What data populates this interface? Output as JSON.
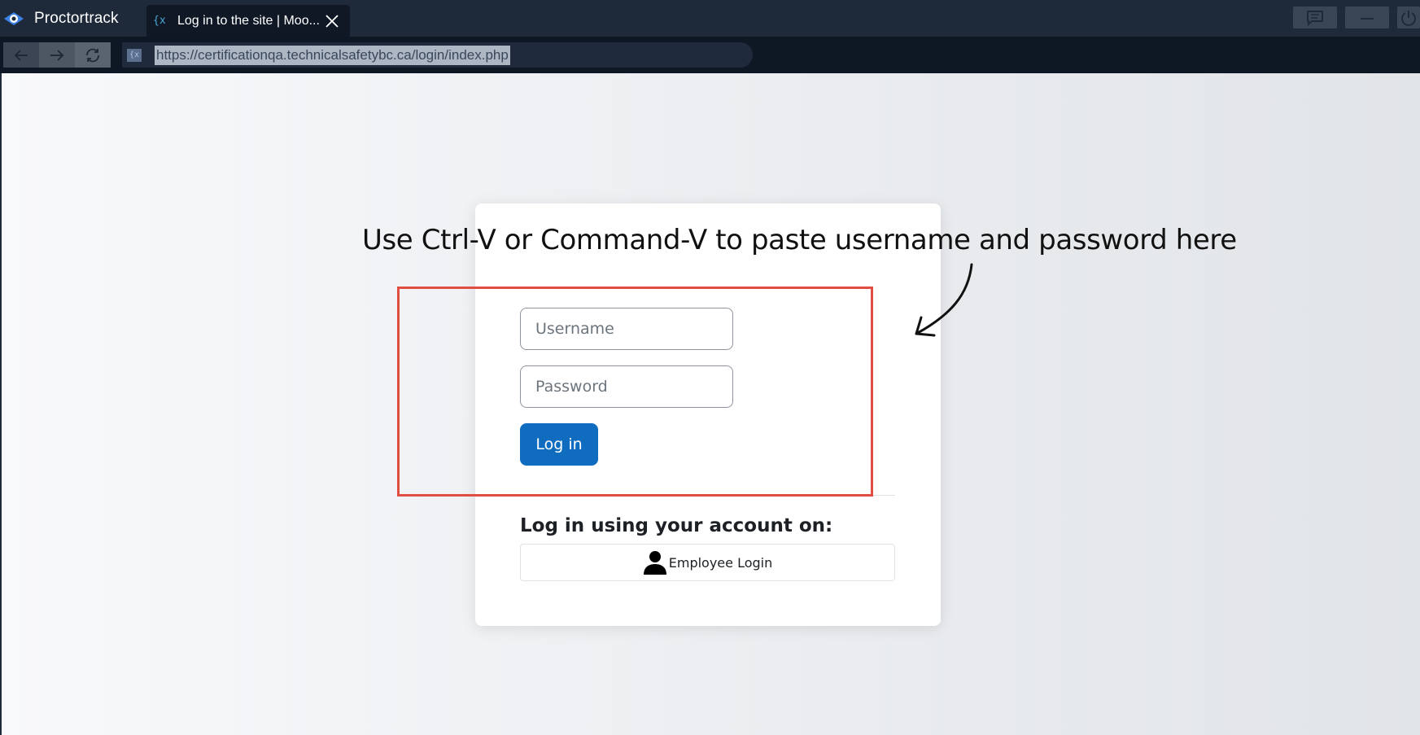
{
  "app": {
    "name": "Proctortrack",
    "logo_icon": "eye-logo-icon",
    "accent": "#3b82e6"
  },
  "tab": {
    "title": "Log in to the site | Moo...",
    "favicon": "moodle-favicon-icon",
    "close_icon": "close-icon"
  },
  "window_buttons": [
    "chat-icon",
    "minimize-icon",
    "power-icon"
  ],
  "navigation": {
    "back_icon": "arrow-left-icon",
    "forward_icon": "arrow-right-icon",
    "reload_icon": "reload-icon",
    "url": "https://certificationqa.technicalsafetybc.ca/login/index.php"
  },
  "login": {
    "username_placeholder": "Username",
    "password_placeholder": "Password",
    "login_button": "Log in",
    "alt_heading": "Log in using your account on:",
    "idp_button": "Employee Login",
    "brand_color": "#0f6cbf"
  },
  "annotation": {
    "text": "Use Ctrl-V or Command-V to paste username and password here",
    "highlight_color": "#e24d42"
  }
}
